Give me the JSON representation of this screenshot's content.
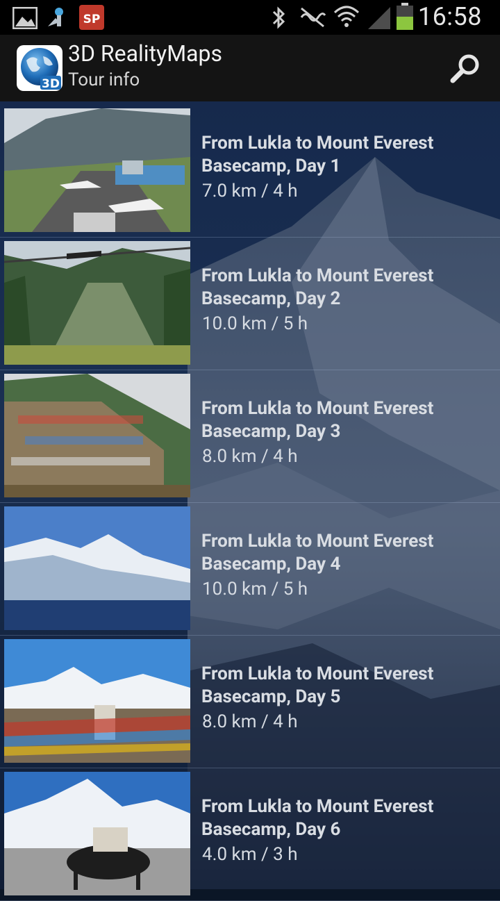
{
  "status_bar": {
    "time": "16:58",
    "left_icons": [
      "image-icon",
      "location-icon",
      "sp-app-icon"
    ],
    "right_icons": [
      "bluetooth-icon",
      "nfc-muted-icon",
      "wifi-icon",
      "signal-icon",
      "battery-icon"
    ],
    "sp_badge": "SP"
  },
  "action_bar": {
    "title": "3D RealityMaps",
    "subtitle": "Tour info",
    "logo_text": "3D"
  },
  "tours": [
    {
      "title": "From Lukla to Mount Everest Basecamp, Day 1",
      "meta": "7.0 km / 4 h"
    },
    {
      "title": "From Lukla to Mount Everest Basecamp, Day 2",
      "meta": "10.0 km / 5 h"
    },
    {
      "title": "From Lukla to Mount Everest Basecamp, Day 3",
      "meta": "8.0 km / 4 h"
    },
    {
      "title": "From Lukla to Mount Everest Basecamp, Day 4",
      "meta": "10.0 km / 5 h"
    },
    {
      "title": "From Lukla to Mount Everest Basecamp, Day 5",
      "meta": "8.0 km / 4 h"
    },
    {
      "title": "From Lukla to Mount Everest Basecamp, Day 6",
      "meta": "4.0 km / 3 h"
    }
  ],
  "colors": {
    "action_bar": "#141414",
    "status_bar": "#000000",
    "battery": "#8cc63f",
    "list_text": "#d9dde3"
  }
}
